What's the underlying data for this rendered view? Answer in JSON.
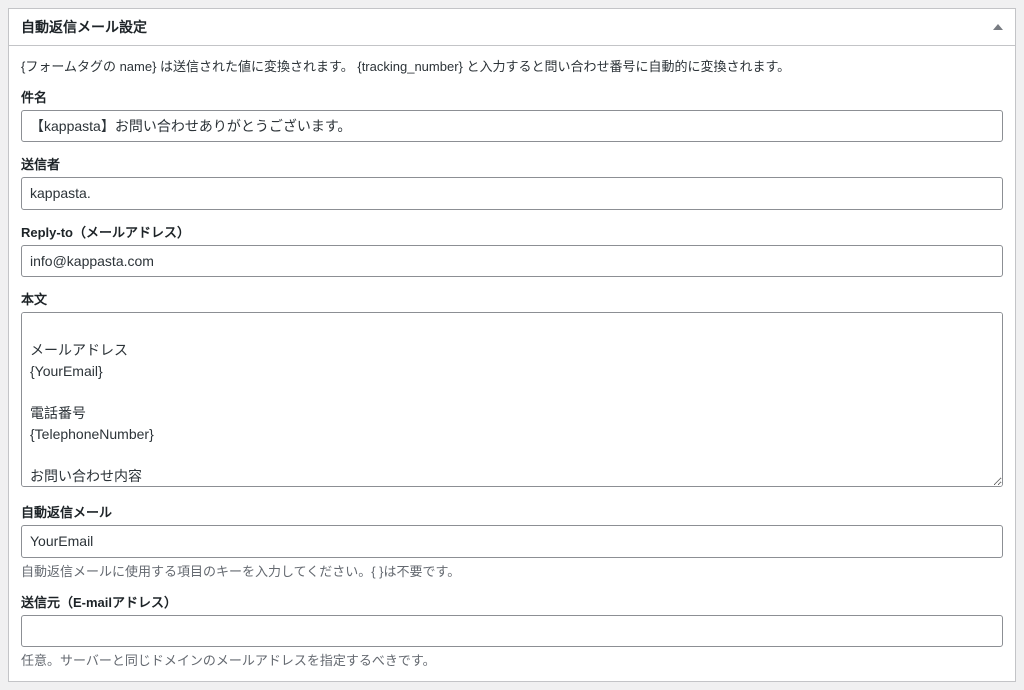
{
  "panel": {
    "title": "自動返信メール設定",
    "description": "{フォームタグの name} は送信された値に変換されます。 {tracking_number} と入力すると問い合わせ番号に自動的に変換されます。"
  },
  "fields": {
    "subject": {
      "label": "件名",
      "value": "【kappasta】お問い合わせありがとうございます。"
    },
    "sender": {
      "label": "送信者",
      "value": "kappasta."
    },
    "replyTo": {
      "label": "Reply-to（メールアドレス）",
      "value": "info@kappasta.com"
    },
    "body": {
      "label": "本文",
      "value": "\nメールアドレス\n{YourEmail}\n\n電話番号\n{TelephoneNumber}\n\nお問い合わせ内容\n{ContentOfInquiry}\n"
    },
    "autoReplyMail": {
      "label": "自動返信メール",
      "value": "YourEmail",
      "help": "自動返信メールに使用する項目のキーを入力してください。{ }は不要です。"
    },
    "fromEmail": {
      "label": "送信元（E-mailアドレス）",
      "value": "",
      "help": "任意。サーバーと同じドメインのメールアドレスを指定するべきです。"
    }
  }
}
